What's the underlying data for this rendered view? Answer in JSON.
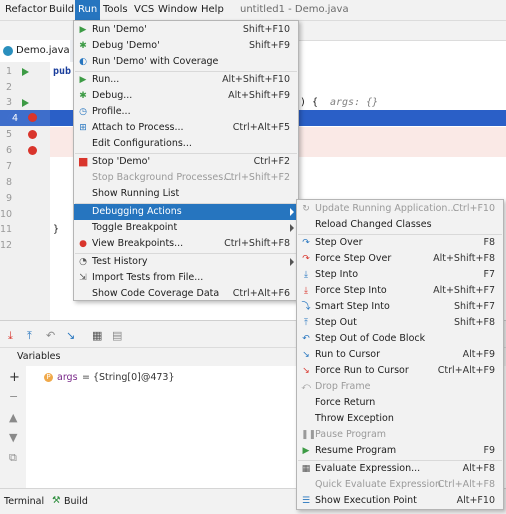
{
  "menubar": {
    "items": [
      "Refactor",
      "Build",
      "Run",
      "Tools",
      "VCS",
      "Window",
      "Help"
    ],
    "title": "untitled1 - Demo.java"
  },
  "editor": {
    "tab_label": "Demo.java",
    "line_numbers": [
      "1",
      "2",
      "3",
      "4",
      "5",
      "6",
      "7",
      "8",
      "9",
      "10",
      "11",
      "12"
    ],
    "code_line1": "pub",
    "code_line3_tail": ") {",
    "code_line3_hint": "args: {}",
    "code_brace": "}"
  },
  "run_menu": {
    "items": [
      {
        "label": "Run 'Demo'",
        "shortcut": "Shift+F10",
        "icon": "play-icon"
      },
      {
        "label": "Debug 'Demo'",
        "shortcut": "Shift+F9",
        "icon": "bug-icon"
      },
      {
        "label": "Run 'Demo' with Coverage",
        "shortcut": "",
        "icon": "coverage-icon"
      },
      {
        "label": "Run...",
        "shortcut": "Alt+Shift+F10",
        "icon": "play-icon"
      },
      {
        "label": "Debug...",
        "shortcut": "Alt+Shift+F9",
        "icon": "bug-icon"
      },
      {
        "label": "Profile...",
        "shortcut": "",
        "icon": "profile-icon"
      },
      {
        "label": "Attach to Process...",
        "shortcut": "Ctrl+Alt+F5",
        "icon": "attach-icon"
      },
      {
        "label": "Edit Configurations...",
        "shortcut": "",
        "icon": ""
      },
      {
        "label": "Stop 'Demo'",
        "shortcut": "Ctrl+F2",
        "icon": "stop-icon"
      },
      {
        "label": "Stop Background Processes...",
        "shortcut": "Ctrl+Shift+F2",
        "icon": ""
      },
      {
        "label": "Show Running List",
        "shortcut": "",
        "icon": ""
      },
      {
        "label": "Debugging Actions",
        "shortcut": "",
        "icon": ""
      },
      {
        "label": "Toggle Breakpoint",
        "shortcut": "",
        "icon": ""
      },
      {
        "label": "View Breakpoints...",
        "shortcut": "Ctrl+Shift+F8",
        "icon": "breakpoints-icon"
      },
      {
        "label": "Test History",
        "shortcut": "",
        "icon": "history-icon"
      },
      {
        "label": "Import Tests from File...",
        "shortcut": "",
        "icon": "import-icon"
      },
      {
        "label": "Show Code Coverage Data",
        "shortcut": "Ctrl+Alt+F6",
        "icon": ""
      }
    ]
  },
  "debug_submenu": {
    "items": [
      {
        "label": "Update Running Application...",
        "shortcut": "Ctrl+F10",
        "icon": "update-icon"
      },
      {
        "label": "Reload Changed Classes",
        "shortcut": "",
        "icon": ""
      },
      {
        "label": "Step Over",
        "shortcut": "F8",
        "icon": "step-over-icon"
      },
      {
        "label": "Force Step Over",
        "shortcut": "Alt+Shift+F8",
        "icon": "force-step-over-icon"
      },
      {
        "label": "Step Into",
        "shortcut": "F7",
        "icon": "step-into-icon"
      },
      {
        "label": "Force Step Into",
        "shortcut": "Alt+Shift+F7",
        "icon": "force-step-into-icon"
      },
      {
        "label": "Smart Step Into",
        "shortcut": "Shift+F7",
        "icon": "smart-step-into-icon"
      },
      {
        "label": "Step Out",
        "shortcut": "Shift+F8",
        "icon": "step-out-icon"
      },
      {
        "label": "Step Out of Code Block",
        "shortcut": "",
        "icon": "step-out-block-icon"
      },
      {
        "label": "Run to Cursor",
        "shortcut": "Alt+F9",
        "icon": "run-to-cursor-icon"
      },
      {
        "label": "Force Run to Cursor",
        "shortcut": "Ctrl+Alt+F9",
        "icon": "force-run-to-cursor-icon"
      },
      {
        "label": "Drop Frame",
        "shortcut": "",
        "icon": "drop-frame-icon"
      },
      {
        "label": "Force Return",
        "shortcut": "",
        "icon": ""
      },
      {
        "label": "Throw Exception",
        "shortcut": "",
        "icon": ""
      },
      {
        "label": "Pause Program",
        "shortcut": "",
        "icon": "pause-icon"
      },
      {
        "label": "Resume Program",
        "shortcut": "F9",
        "icon": "resume-icon"
      },
      {
        "label": "Evaluate Expression...",
        "shortcut": "Alt+F8",
        "icon": "calculator-icon"
      },
      {
        "label": "Quick Evaluate Expression",
        "shortcut": "Ctrl+Alt+F8",
        "icon": ""
      },
      {
        "label": "Show Execution Point",
        "shortcut": "Alt+F10",
        "icon": "execution-point-icon"
      }
    ]
  },
  "debug_panel": {
    "variables_header": "Variables",
    "variable_name": "args",
    "variable_value": "= {String[0]@473}",
    "variable_badge": "P"
  },
  "statusbar": {
    "terminal_label": "Terminal",
    "build_label": "Build"
  },
  "colors": {
    "accent": "#2675bf",
    "current_line": "#2a5fc7",
    "breakpoint_line": "#fae9e6",
    "breakpoint": "#d9352c",
    "run_green": "#3d9b45"
  }
}
